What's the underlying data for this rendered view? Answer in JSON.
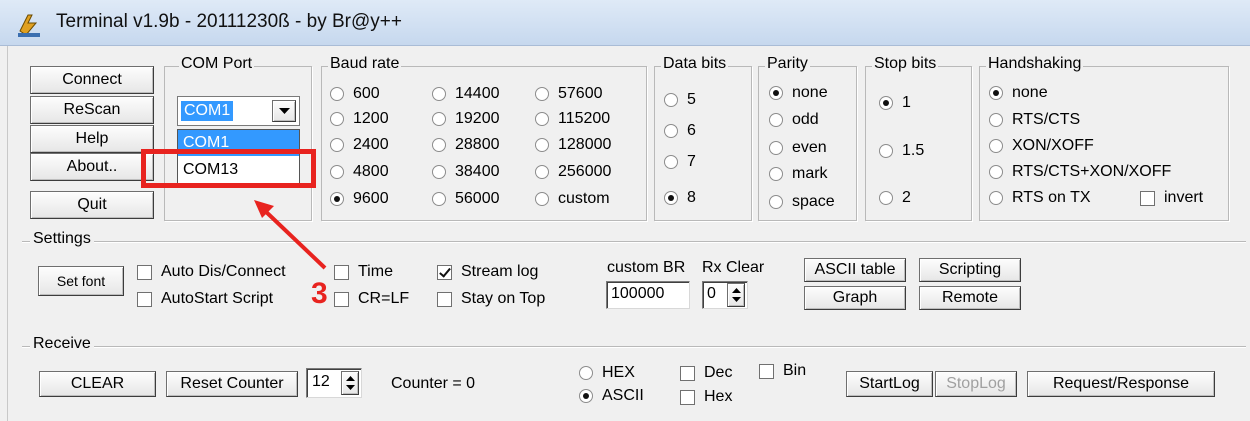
{
  "window": {
    "title": "Terminal v1.9b - 20111230ß - by Br@y++"
  },
  "left_buttons": [
    {
      "label": "Connect"
    },
    {
      "label": "ReScan"
    },
    {
      "label": "Help"
    },
    {
      "label": "About.."
    },
    {
      "label": "Quit"
    }
  ],
  "com_port": {
    "legend": "COM Port",
    "selected": "COM1",
    "options": [
      "COM1",
      "COM13"
    ]
  },
  "baud_rate": {
    "legend": "Baud rate",
    "options": [
      "600",
      "1200",
      "2400",
      "4800",
      "9600",
      "14400",
      "19200",
      "28800",
      "38400",
      "56000",
      "57600",
      "115200",
      "128000",
      "256000",
      "custom"
    ],
    "selected": "9600"
  },
  "data_bits": {
    "legend": "Data bits",
    "options": [
      "5",
      "6",
      "7",
      "8"
    ],
    "selected": "8"
  },
  "parity": {
    "legend": "Parity",
    "options": [
      "none",
      "odd",
      "even",
      "mark",
      "space"
    ],
    "selected": "none"
  },
  "stop_bits": {
    "legend": "Stop bits",
    "options": [
      "1",
      "1.5",
      "2"
    ],
    "selected": "1"
  },
  "handshaking": {
    "legend": "Handshaking",
    "options": [
      "none",
      "RTS/CTS",
      "XON/XOFF",
      "RTS/CTS+XON/XOFF",
      "RTS on TX"
    ],
    "selected": "none",
    "invert_label": "invert",
    "invert_checked": false
  },
  "settings": {
    "legend": "Settings",
    "set_font": "Set font",
    "checks": {
      "auto_dis_connect": {
        "label": "Auto Dis/Connect",
        "checked": false
      },
      "autostart_script": {
        "label": "AutoStart Script",
        "checked": false
      },
      "time": {
        "label": "Time",
        "checked": false
      },
      "cr_lf": {
        "label": "CR=LF",
        "checked": false
      },
      "stream_log": {
        "label": "Stream log",
        "checked": true
      },
      "stay_on_top": {
        "label": "Stay on Top",
        "checked": false
      }
    },
    "custom_br_label": "custom BR",
    "custom_br_value": "100000",
    "rx_clear_label": "Rx Clear",
    "rx_clear_value": "0",
    "ascii_table": "ASCII table",
    "scripting": "Scripting",
    "graph": "Graph",
    "remote": "Remote"
  },
  "receive": {
    "legend": "Receive",
    "clear": "CLEAR",
    "reset_counter": "Reset Counter",
    "counter_spin_value": "12",
    "counter_label": "Counter = 0",
    "format_options": [
      "HEX",
      "ASCII"
    ],
    "format_selected": "ASCII",
    "checks": {
      "dec": {
        "label": "Dec",
        "checked": false
      },
      "bin": {
        "label": "Bin",
        "checked": false
      },
      "hex": {
        "label": "Hex",
        "checked": false
      }
    },
    "start_log": "StartLog",
    "stop_log": "StopLog",
    "request_response": "Request/Response"
  },
  "annotation": {
    "step_number": "3",
    "color": "#e8231f"
  },
  "colors": {
    "selection": "#3399ff",
    "annotation": "#e8231f"
  }
}
